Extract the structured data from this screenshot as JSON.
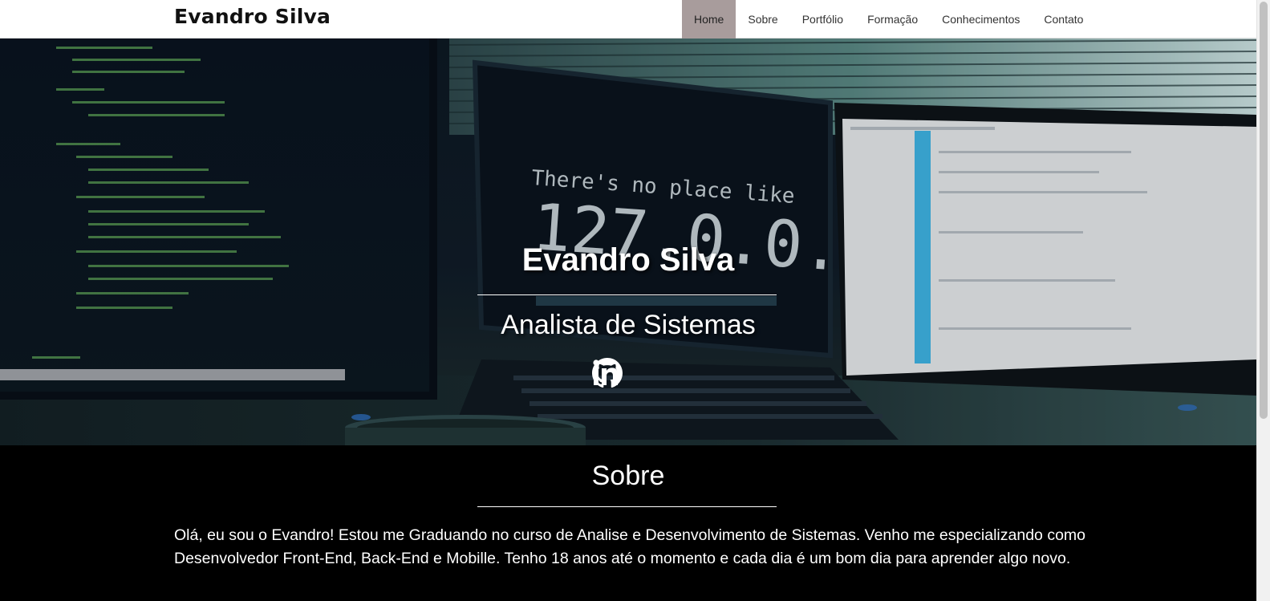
{
  "navbar": {
    "brand": "Evandro Silva",
    "items": [
      {
        "label": "Home",
        "active": true
      },
      {
        "label": "Sobre",
        "active": false
      },
      {
        "label": "Portfólio",
        "active": false
      },
      {
        "label": "Formação",
        "active": false
      },
      {
        "label": "Conhecimentos",
        "active": false
      },
      {
        "label": "Contato",
        "active": false
      }
    ]
  },
  "hero": {
    "background_image_text": {
      "line1": "There's no place like",
      "line2": "127.0.0.1"
    },
    "title": "Evandro Silva",
    "subtitle": "Analista de Sistemas",
    "social": [
      {
        "icon": "github-icon"
      },
      {
        "icon": "linkedin-icon"
      }
    ]
  },
  "about": {
    "title": "Sobre",
    "text": "Olá, eu sou o Evandro! Estou me Graduando no curso de Analise e Desenvolvimento de Sistemas. Venho me especializando como Desenvolvedor Front-End, Back-End e Mobille. Tenho 18 anos até o momento e cada dia é um bom dia para aprender algo novo."
  },
  "colors": {
    "nav_active_bg": "#a89c9c",
    "about_bg": "#000000",
    "text_light": "#ffffff"
  }
}
